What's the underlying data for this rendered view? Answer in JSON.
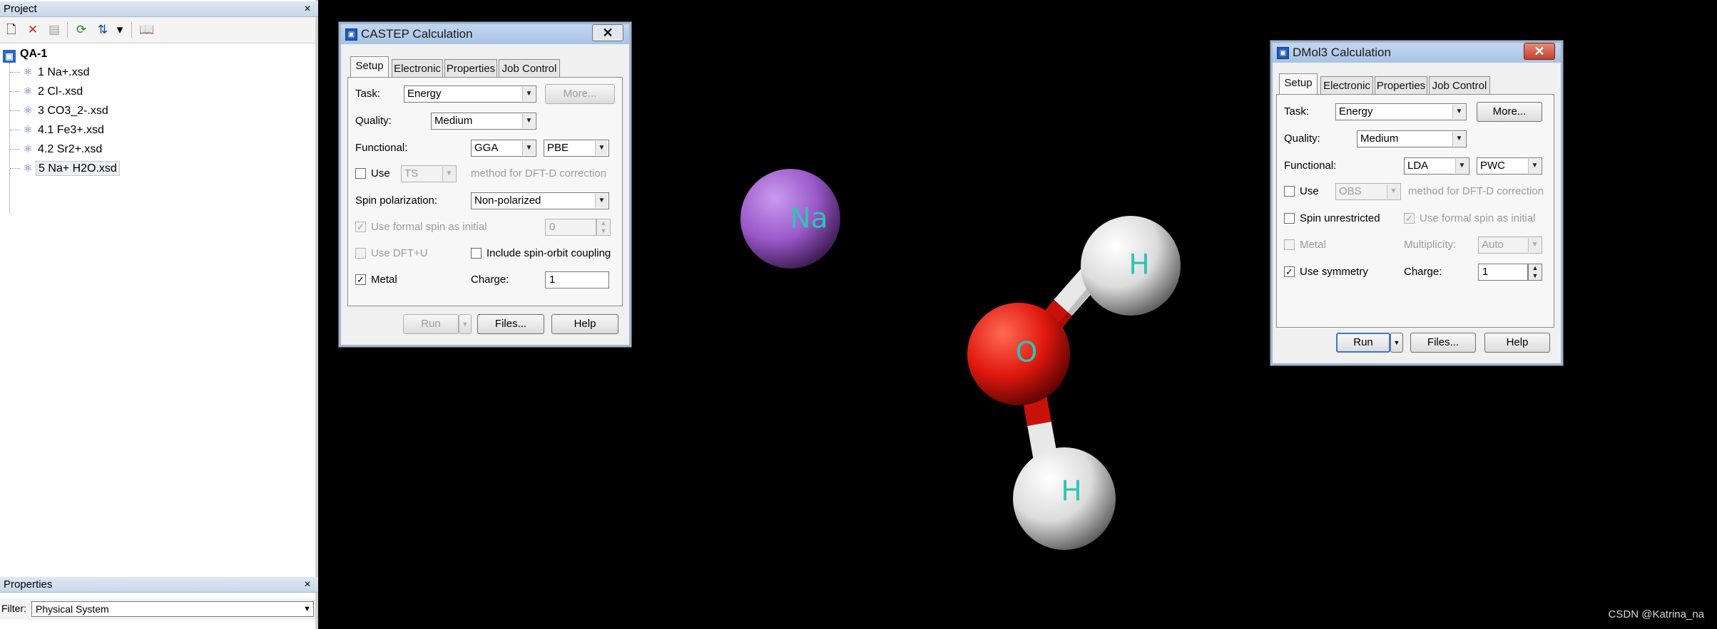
{
  "project_panel": {
    "title": "Project",
    "close_glyph": "×",
    "toolbar": [
      {
        "icon": "new-document-icon",
        "glyph": "🗋"
      },
      {
        "icon": "delete-icon",
        "glyph": "✕"
      },
      {
        "icon": "properties-icon",
        "glyph": "▤"
      },
      {
        "icon": "refresh-icon",
        "glyph": "⟳"
      },
      {
        "icon": "sort-icon",
        "glyph": "⇅"
      },
      {
        "icon": "sort-dropdown-icon",
        "glyph": "▾"
      },
      {
        "icon": "book-icon",
        "glyph": "📖"
      }
    ],
    "tree": {
      "root": "QA-1",
      "items": [
        "1 Na+.xsd",
        "2 Cl-.xsd",
        "3 CO3_2-.xsd",
        "4.1 Fe3+.xsd",
        "4.2 Sr2+.xsd",
        "5 Na+ H2O.xsd"
      ],
      "selected_index": 5
    }
  },
  "properties_panel": {
    "title": "Properties",
    "close_glyph": "×",
    "filter_label": "Filter:",
    "filter_value": "Physical System"
  },
  "castep": {
    "title": "CASTEP Calculation",
    "close_glyph": "✕",
    "tabs": [
      "Setup",
      "Electronic",
      "Properties",
      "Job Control"
    ],
    "active_tab": "Setup",
    "task_label": "Task:",
    "task_value": "Energy",
    "more_label": "More...",
    "quality_label": "Quality:",
    "quality_value": "Medium",
    "functional_label": "Functional:",
    "functional_value": "GGA",
    "functional_sub_value": "PBE",
    "use_label": "Use",
    "use_checked": false,
    "dispersion_value": "TS",
    "dispersion_text": "method for DFT-D correction",
    "spin_label": "Spin polarization:",
    "spin_value": "Non-polarized",
    "formal_spin_label": "Use formal spin as initial",
    "formal_spin_checked": true,
    "formal_spin_value": "0",
    "dftu_label": "Use DFT+U",
    "dftu_checked": false,
    "soc_label": "Include spin-orbit coupling",
    "soc_checked": false,
    "metal_label": "Metal",
    "metal_checked": true,
    "charge_label": "Charge:",
    "charge_value": "1",
    "run_label": "Run",
    "files_label": "Files...",
    "help_label": "Help"
  },
  "dmol3": {
    "title": "DMol3 Calculation",
    "close_glyph": "✕",
    "tabs": [
      "Setup",
      "Electronic",
      "Properties",
      "Job Control"
    ],
    "active_tab": "Setup",
    "task_label": "Task:",
    "task_value": "Energy",
    "more_label": "More...",
    "quality_label": "Quality:",
    "quality_value": "Medium",
    "functional_label": "Functional:",
    "functional_value": "LDA",
    "functional_sub_value": "PWC",
    "use_label": "Use",
    "use_checked": false,
    "dispersion_value": "OBS",
    "dispersion_text": "method for DFT-D correction",
    "spin_unrestricted_label": "Spin unrestricted",
    "spin_unrestricted_checked": false,
    "formal_spin_label": "Use formal spin as initial",
    "formal_spin_checked": true,
    "metal_label": "Metal",
    "metal_checked": false,
    "multiplicity_label": "Multiplicity:",
    "multiplicity_value": "Auto",
    "symmetry_label": "Use symmetry",
    "symmetry_checked": true,
    "charge_label": "Charge:",
    "charge_value": "1",
    "run_label": "Run",
    "files_label": "Files...",
    "help_label": "Help"
  },
  "molecule": {
    "atoms": [
      {
        "element": "Na",
        "color": "#9b59c9"
      },
      {
        "element": "O",
        "color": "#e0180e"
      },
      {
        "element": "H",
        "color": "#e4e4e4"
      },
      {
        "element": "H",
        "color": "#e4e4e4"
      }
    ],
    "label_color": "#2ec4b6"
  },
  "watermark": "CSDN @Katrina_na",
  "colors": {
    "viewport_background": "#000000",
    "panel_header": "#c9d6ea",
    "dialog_title": "#a9c3e4"
  }
}
